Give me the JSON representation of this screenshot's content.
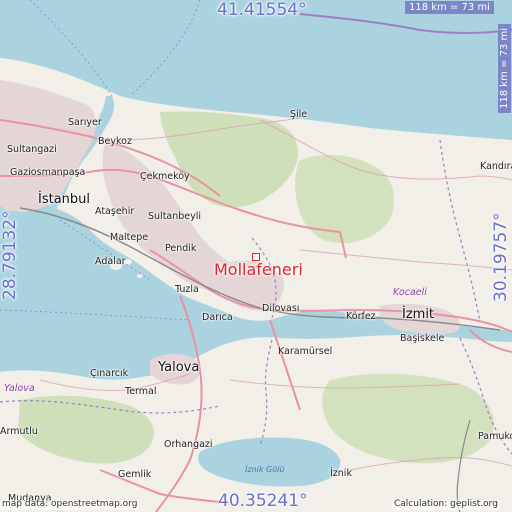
{
  "coords": {
    "north": "41.41554°",
    "south": "40.35241°",
    "west": "28.79132°",
    "east": "30.19757°"
  },
  "scale": {
    "horizontal": "118 km = 73 mi",
    "vertical": "118 km = 73 mi"
  },
  "selected_place": {
    "name": "Mollafeneri"
  },
  "places": {
    "sile": "Şile",
    "sariyer": "Sarıyer",
    "beykoz": "Beykoz",
    "sultangazi": "Sultangazi",
    "gaziosmanpasa": "Gaziosmanpaşa",
    "cekmekoy": "Çekmeköy",
    "istanbul": "İstanbul",
    "atasehir": "Ataşehir",
    "sultanbeyli": "Sultanbeyli",
    "maltepe": "Maltepe",
    "pendik": "Pendik",
    "adalar": "Adalar",
    "tuzla": "Tuzla",
    "darica": "Darıca",
    "dilovasi": "Dilovası",
    "korfez": "Körfez",
    "izmit": "İzmit",
    "kocaeli": "Kocaeli",
    "basiskele": "Başiskele",
    "kandira": "Kandıra",
    "karamursel": "Karamürsel",
    "yalova": "Yalova",
    "yalova_prov": "Yalova",
    "cinarcik": "Çınarcık",
    "termal": "Termal",
    "armutlu": "Armutlu",
    "orhangazi": "Orhangazi",
    "gemlik": "Gemlik",
    "mudanya": "Mudanya",
    "iznik": "İznik",
    "iznik_golu": "İznik Gölü",
    "pamukova": "Pamuko"
  },
  "credits": {
    "left": "map data: openstreetmap.org",
    "right": "Calculation: geplist.org"
  },
  "colors": {
    "water": "#aad3df",
    "land": "#f2efe9",
    "forest": "#c8dcb0",
    "urban": "#e4d6d6",
    "motorway": "#e892a2",
    "border": "#9e7fbf",
    "accent": "#e0242b",
    "coord": "#6a6fd0"
  }
}
